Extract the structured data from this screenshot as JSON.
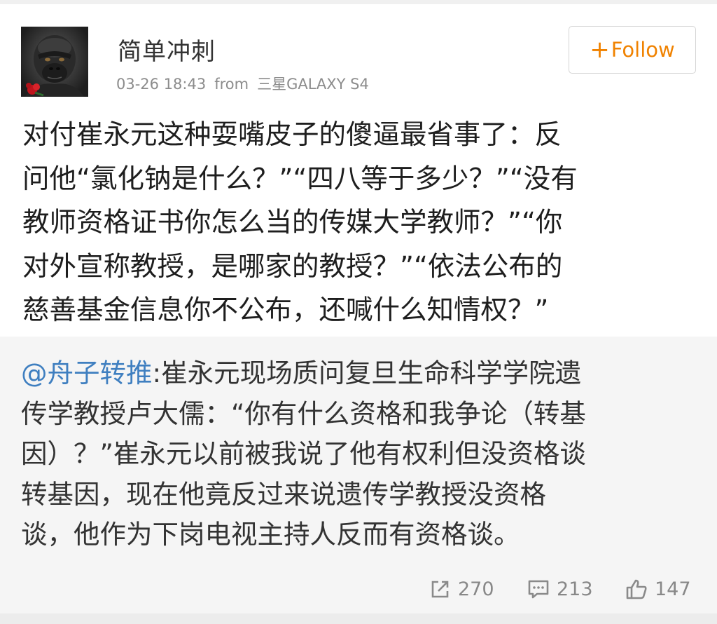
{
  "post": {
    "username": "简单冲刺",
    "timestamp": "03-26 18:43",
    "source_prefix": "from",
    "source": "三星GALAXY S4",
    "follow_plus": "+",
    "follow_label": "Follow",
    "text_lines": [
      "对付崔永元这种耍嘴皮子的傻逼最省事了：反",
      "问他“氯化钠是什么？”“四八等于多少？”“没有",
      "教师资格证书你怎么当的传媒大学教师？”“你",
      "对外宣称教授，是哪家的教授？”“依法公布的",
      "慈善基金信息你不公布，还喊什么知情权？”"
    ]
  },
  "repost": {
    "mention": "@舟子转推",
    "line1_rest": ":崔永元现场质问复旦生命科学学院遗",
    "text_lines": [
      "传学教授卢大儒：“你有什么资格和我争论（转基",
      "因）？”崔永元以前被我说了他有权利但没资格谈",
      "转基因，现在他竟反过来说遗传学教授没资格",
      "谈，他作为下岗电视主持人反而有资格谈。"
    ],
    "stats": {
      "reposts": "270",
      "comments": "213",
      "likes": "147"
    }
  },
  "colors": {
    "follow_orange": "#f08200",
    "mention_blue": "#3f7fc0",
    "meta_gray": "#8c8c8c",
    "repost_bg": "#f5f5f5"
  },
  "icons": {
    "avatar": "gorilla-avatar",
    "share": "share-icon",
    "comment": "comment-icon",
    "like": "thumbs-up-icon"
  }
}
